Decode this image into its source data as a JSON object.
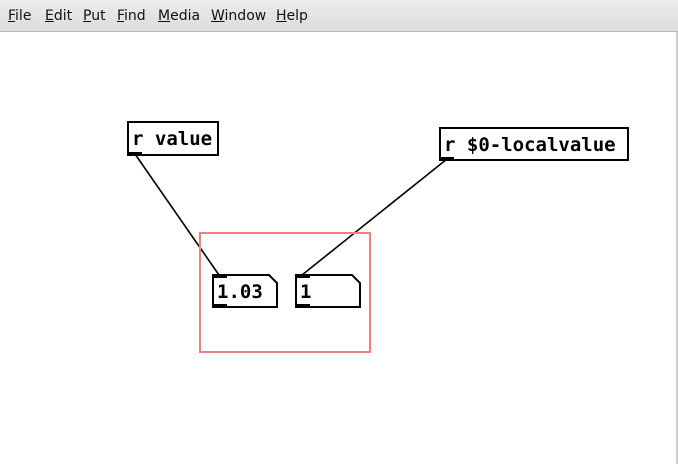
{
  "menu": {
    "items": [
      {
        "mnemonic": "F",
        "rest": "ile"
      },
      {
        "mnemonic": "E",
        "rest": "dit"
      },
      {
        "mnemonic": "P",
        "rest": "ut"
      },
      {
        "mnemonic": "F",
        "rest": "ind"
      },
      {
        "mnemonic": "M",
        "rest": "edia"
      },
      {
        "mnemonic": "W",
        "rest": "indow"
      },
      {
        "mnemonic": "H",
        "rest": "elp"
      }
    ]
  },
  "patch": {
    "objects": [
      {
        "text": "r value"
      },
      {
        "text": "r $0-localvalue"
      }
    ],
    "number_boxes": [
      {
        "value": "1.03"
      },
      {
        "value": "1"
      }
    ]
  },
  "colors": {
    "selection": "#f08080",
    "box_border": "#000000",
    "wire": "#000000"
  }
}
